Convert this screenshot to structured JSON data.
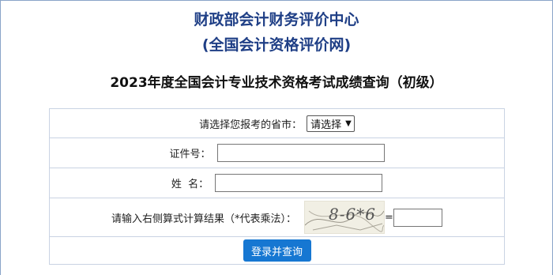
{
  "header": {
    "org_line1": "财政部会计财务评价中心",
    "org_line2": "(全国会计资格评价网)",
    "query_title": "2023年度全国会计专业技术资格考试成绩查询（初级）"
  },
  "form": {
    "province_label": "请选择您报考的省市：",
    "province_selected": "请选择",
    "id_label": "证件号：",
    "id_value": "",
    "name_label": "姓  名：",
    "name_value": "",
    "captcha_label": "请输入右侧算式计算结果（*代表乘法）：",
    "captcha_image_text": "8-6*6",
    "captcha_equals": "=",
    "captcha_value": "",
    "submit_label": "登录并查询"
  },
  "colors": {
    "org_title": "#1f3f86",
    "submit_button": "#1677d2",
    "table_border": "#c9d3e3"
  }
}
